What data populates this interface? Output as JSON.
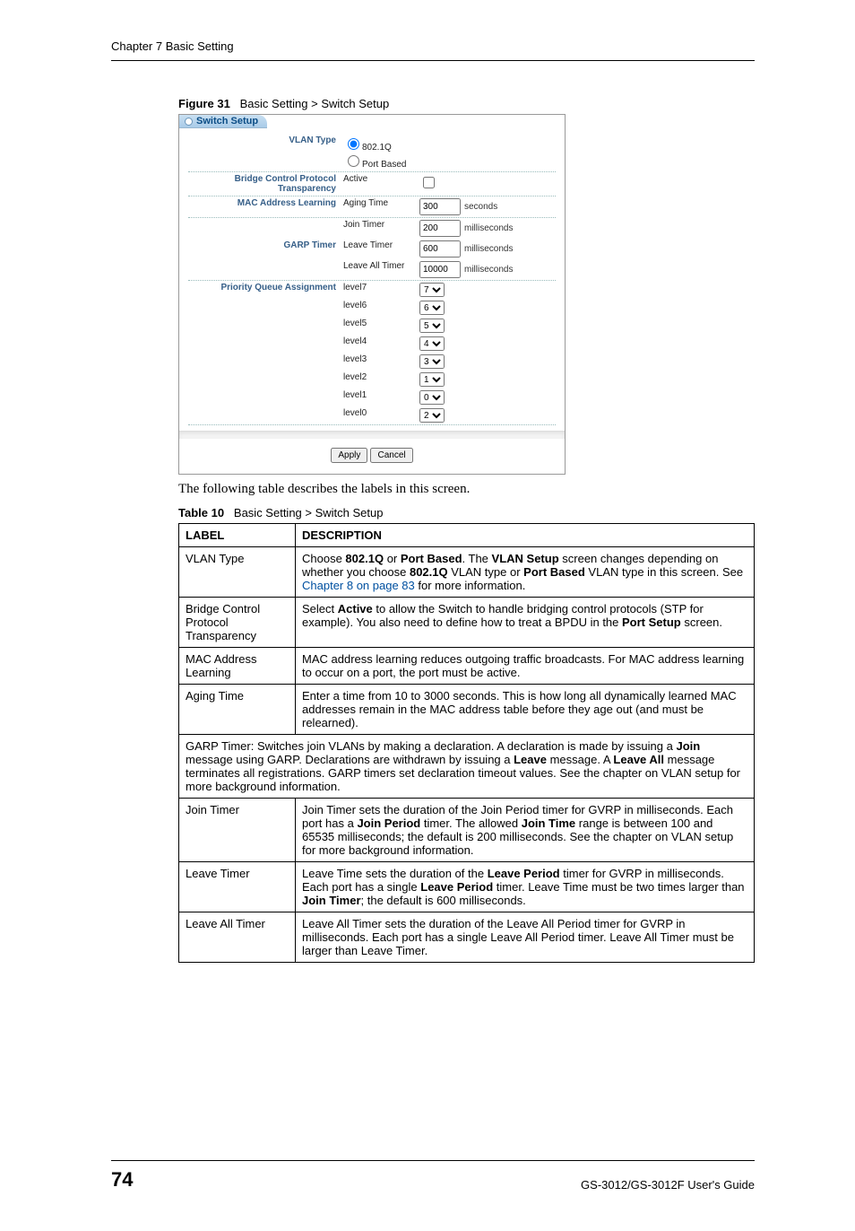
{
  "header": "Chapter 7 Basic Setting",
  "figure": {
    "label": "Figure 31",
    "title": "Basic Setting > Switch Setup"
  },
  "screenshot": {
    "tab": "Switch Setup",
    "rows": {
      "vlan_type": {
        "label": "VLAN Type",
        "opt1": "802.1Q",
        "opt2": "Port Based"
      },
      "bridge": {
        "label": "Bridge Control Protocol Transparency",
        "sub": "Active"
      },
      "mac": {
        "label": "MAC Address Learning",
        "sub": "Aging Time",
        "val": "300",
        "unit": "seconds"
      },
      "garp": {
        "label": "GARP Timer",
        "join": {
          "sub": "Join Timer",
          "val": "200",
          "unit": "milliseconds"
        },
        "leave": {
          "sub": "Leave Timer",
          "val": "600",
          "unit": "milliseconds"
        },
        "leaveall": {
          "sub": "Leave All Timer",
          "val": "10000",
          "unit": "milliseconds"
        }
      },
      "pqa": {
        "label": "Priority Queue Assignment",
        "levels": [
          {
            "name": "level7",
            "val": "7"
          },
          {
            "name": "level6",
            "val": "6"
          },
          {
            "name": "level5",
            "val": "5"
          },
          {
            "name": "level4",
            "val": "4"
          },
          {
            "name": "level3",
            "val": "3"
          },
          {
            "name": "level2",
            "val": "1"
          },
          {
            "name": "level1",
            "val": "0"
          },
          {
            "name": "level0",
            "val": "2"
          }
        ]
      }
    },
    "buttons": {
      "apply": "Apply",
      "cancel": "Cancel"
    }
  },
  "intro": "The following table describes the labels in this screen.",
  "table_caption": {
    "label": "Table 10",
    "title": "Basic Setting > Switch Setup"
  },
  "table": {
    "head": {
      "c1": "LABEL",
      "c2": "DESCRIPTION"
    },
    "rows": [
      {
        "label": "VLAN Type",
        "desc_pre": "Choose ",
        "b1": "802.1Q",
        "d1": " or ",
        "b2": "Port Based",
        "d2": ". The ",
        "b3": "VLAN Setup",
        "d3": " screen changes depending on whether you choose ",
        "b4": "802.1Q",
        "d4": " VLAN type or ",
        "b5": "Port Based",
        "d5": " VLAN type in this screen. See ",
        "link": "Chapter 8 on page 83",
        "d6": " for more information."
      },
      {
        "label": "Bridge Control Protocol Transparency",
        "desc_pre": "Select ",
        "b1": "Active",
        "d1": " to allow the Switch to handle bridging control protocols (STP for example). You also need to define how to treat a BPDU in the ",
        "b2": "Port Setup",
        "d2": " screen."
      },
      {
        "label": "MAC Address Learning",
        "desc": "MAC address learning reduces outgoing traffic broadcasts. For MAC address learning to occur on a port, the port must be active."
      },
      {
        "label": "Aging Time",
        "desc": "Enter a time from 10 to 3000 seconds. This is how long all dynamically learned MAC addresses remain in the MAC address table before they age out (and must be relearned)."
      },
      {
        "span": true,
        "desc_pre": "GARP Timer: Switches join VLANs by making a declaration. A declaration is made by issuing a ",
        "b1": "Join",
        "d1": " message using GARP. Declarations are withdrawn by issuing a ",
        "b2": "Leave",
        "d2": " message. A ",
        "b3": "Leave All",
        "d3": " message terminates all registrations. GARP timers set declaration timeout values. See the chapter on VLAN setup for more background information."
      },
      {
        "label": "Join Timer",
        "desc_pre": "Join Timer sets the duration of the Join Period timer for GVRP in milliseconds. Each port has a ",
        "b1": "Join Period",
        "d1": " timer. The allowed ",
        "b2": "Join Time",
        "d2": " range is between 100 and 65535 milliseconds; the default is 200 milliseconds. See the chapter on VLAN setup for more background information."
      },
      {
        "label": "Leave Timer",
        "desc_pre": "Leave Time sets the duration of the ",
        "b1": "Leave Period",
        "d1": " timer for GVRP in milliseconds. Each port has a single ",
        "b2": "Leave Period",
        "d2": " timer. Leave Time must be two times larger than ",
        "b3": "Join Timer",
        "d3": "; the default is 600 milliseconds."
      },
      {
        "label": "Leave All Timer",
        "desc": "Leave All Timer sets the duration of the Leave All Period timer for GVRP in milliseconds. Each port has a single Leave All Period timer. Leave All Timer must be larger than Leave Timer."
      }
    ]
  },
  "footer": {
    "page": "74",
    "guide": "GS-3012/GS-3012F User's Guide"
  }
}
